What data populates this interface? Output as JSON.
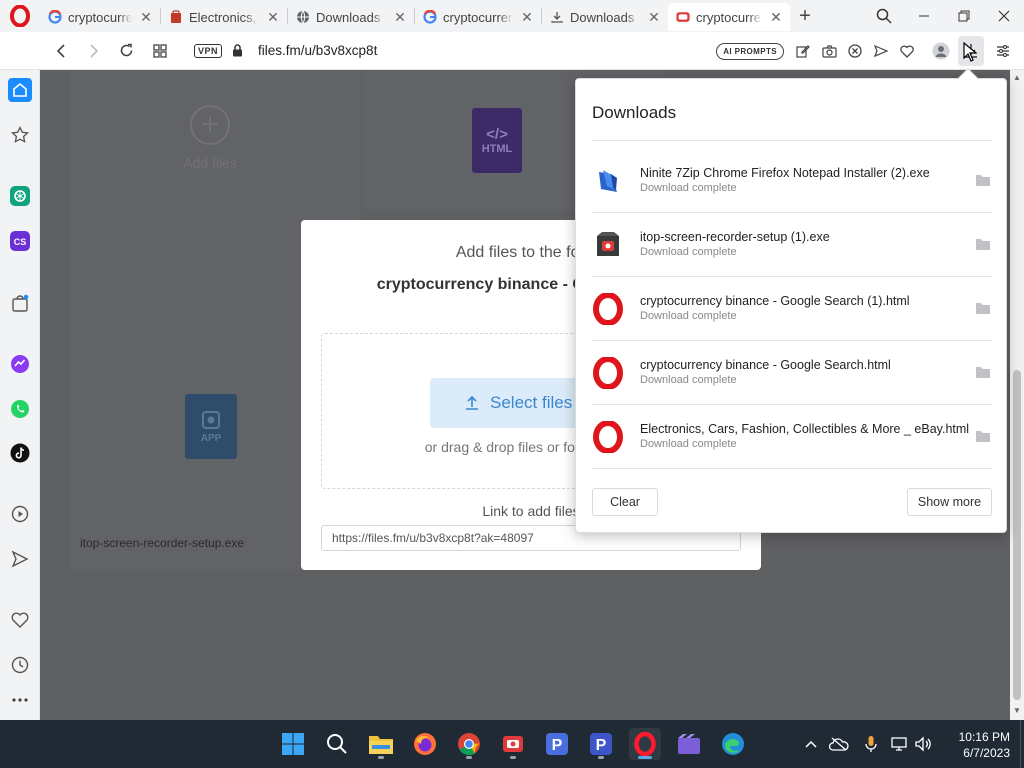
{
  "browser": {
    "tabs": [
      {
        "title": "cryptocurrency binance - Google Search",
        "favicon": "google-icon",
        "active": false
      },
      {
        "title": "Electronics, Cars, Fashion, Collectibles",
        "favicon": "ebay-icon",
        "active": false
      },
      {
        "title": "Downloads",
        "favicon": "globe-icon",
        "active": false
      },
      {
        "title": "cryptocurrency binance - Google Search",
        "favicon": "google-icon",
        "active": false
      },
      {
        "title": "Downloads",
        "favicon": "download-icon",
        "active": false
      },
      {
        "title": "cryptocurrency binance - Files.fm",
        "favicon": "filesfm-icon",
        "active": true
      }
    ],
    "address": {
      "vpn_label": "VPN",
      "url": "files.fm/u/b3v8xcp8t",
      "ai_prompts_label": "AI PROMPTS"
    }
  },
  "page": {
    "add_files_label": "Add files",
    "html_file_label": "HTML",
    "app_file_label": "APP",
    "file_caption": "itop-screen-recorder-setup.exe",
    "modal": {
      "title": "Add files to the folder",
      "folder_name": "cryptocurrency binance - Google Search",
      "select_button": "Select files",
      "drag_text": "or drag & drop files or folders here",
      "link_label": "Link to add files",
      "link_value": "https://files.fm/u/b3v8xcp8t?ak=48097"
    }
  },
  "downloads": {
    "title": "Downloads",
    "items": [
      {
        "name": "Ninite 7Zip Chrome Firefox Notepad Installer (2).exe",
        "status": "Download complete",
        "icon": "ninite-icon"
      },
      {
        "name": "itop-screen-recorder-setup (1).exe",
        "status": "Download complete",
        "icon": "itop-installer-icon"
      },
      {
        "name": "cryptocurrency binance - Google Search (1).html",
        "status": "Download complete",
        "icon": "opera-file-icon"
      },
      {
        "name": "cryptocurrency binance - Google Search.html",
        "status": "Download complete",
        "icon": "opera-file-icon"
      },
      {
        "name": "Electronics, Cars, Fashion, Collectibles & More _ eBay.html",
        "status": "Download complete",
        "icon": "opera-file-icon"
      }
    ],
    "clear_label": "Clear",
    "show_more_label": "Show more"
  },
  "taskbar": {
    "time": "10:16 PM",
    "date": "6/7/2023"
  },
  "colors": {
    "opera_red": "#e0141d",
    "taskbar_bg": "#1f2a34",
    "select_button_text": "#3a86d0",
    "sidebar_home_active": "#1a8cff"
  }
}
